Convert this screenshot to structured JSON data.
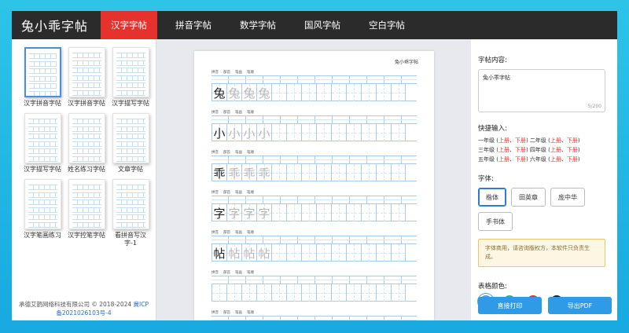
{
  "header": {
    "brand": "兔小乖字帖",
    "tabs": [
      "汉字字帖",
      "拼音字帖",
      "数学字帖",
      "国风字帖",
      "空白字帖"
    ],
    "active_tab": "汉字字帖"
  },
  "templates": [
    {
      "label": "汉字拼音字帖",
      "selected": true
    },
    {
      "label": "汉字拼音字帖",
      "selected": false
    },
    {
      "label": "汉字描写字帖",
      "selected": false
    },
    {
      "label": "汉字描写字帖",
      "selected": false
    },
    {
      "label": "姓名练习字帖",
      "selected": false
    },
    {
      "label": "文章字帖",
      "selected": false
    },
    {
      "label": "汉字笔画练习",
      "selected": false
    },
    {
      "label": "汉字控笔字帖",
      "selected": false
    },
    {
      "label": "看拼音写汉字-1",
      "selected": false
    }
  ],
  "footer": {
    "copyright": "承德艾鹊网络科技有限公司 © 2018-2024",
    "icp": "冀ICP备2021026103号-4"
  },
  "preview": {
    "title": "兔小乖字帖",
    "row_labels": [
      "拼音",
      "部首",
      "笔画",
      "笔顺"
    ],
    "rows": [
      {
        "char": "兔",
        "filled": true
      },
      {
        "char": "小",
        "filled": true
      },
      {
        "char": "乖",
        "filled": true
      },
      {
        "char": "字",
        "filled": true
      },
      {
        "char": "帖",
        "filled": true
      },
      {
        "char": "",
        "filled": false
      },
      {
        "char": "",
        "filled": false
      }
    ]
  },
  "panel": {
    "content_label": "字帖内容:",
    "content_value": "兔小乖字帖",
    "content_count": "5/200",
    "quick_label": "快捷输入:",
    "quick_lines": [
      [
        {
          "t": "一年级",
          "c": "n"
        },
        {
          "t": " (",
          "c": "n"
        },
        {
          "t": "上册",
          "c": "r"
        },
        {
          "t": "、",
          "c": "n"
        },
        {
          "t": "下册",
          "c": "r"
        },
        {
          "t": ") 二年级 (",
          "c": "n"
        },
        {
          "t": "上册",
          "c": "r"
        },
        {
          "t": "、",
          "c": "n"
        },
        {
          "t": "下册",
          "c": "r"
        },
        {
          "t": ")",
          "c": "n"
        }
      ],
      [
        {
          "t": "三年级",
          "c": "n"
        },
        {
          "t": " (",
          "c": "n"
        },
        {
          "t": "上册",
          "c": "r"
        },
        {
          "t": "、",
          "c": "n"
        },
        {
          "t": "下册",
          "c": "r"
        },
        {
          "t": ") 四年级 (",
          "c": "n"
        },
        {
          "t": "上册",
          "c": "r"
        },
        {
          "t": "、",
          "c": "n"
        },
        {
          "t": "下册",
          "c": "r"
        },
        {
          "t": ")",
          "c": "n"
        }
      ],
      [
        {
          "t": "五年级",
          "c": "n"
        },
        {
          "t": " (",
          "c": "n"
        },
        {
          "t": "上册",
          "c": "r"
        },
        {
          "t": "、",
          "c": "n"
        },
        {
          "t": "下册",
          "c": "r"
        },
        {
          "t": ") 六年级 (",
          "c": "n"
        },
        {
          "t": "上册",
          "c": "r"
        },
        {
          "t": "、",
          "c": "n"
        },
        {
          "t": "下册",
          "c": "r"
        },
        {
          "t": ")",
          "c": "n"
        }
      ]
    ],
    "font_label": "字体:",
    "fonts": [
      "楷体",
      "田英章",
      "庞中华",
      "手书体"
    ],
    "active_font": "楷体",
    "notice": "字体商用，请咨询版权方，本软件只负责生成。",
    "color_label": "表格颜色:",
    "colors": [
      "#4aa3df",
      "#2eb872",
      "#e5322d",
      "#222222"
    ],
    "print_button": "直接打印",
    "export_button": "导出PDF"
  }
}
